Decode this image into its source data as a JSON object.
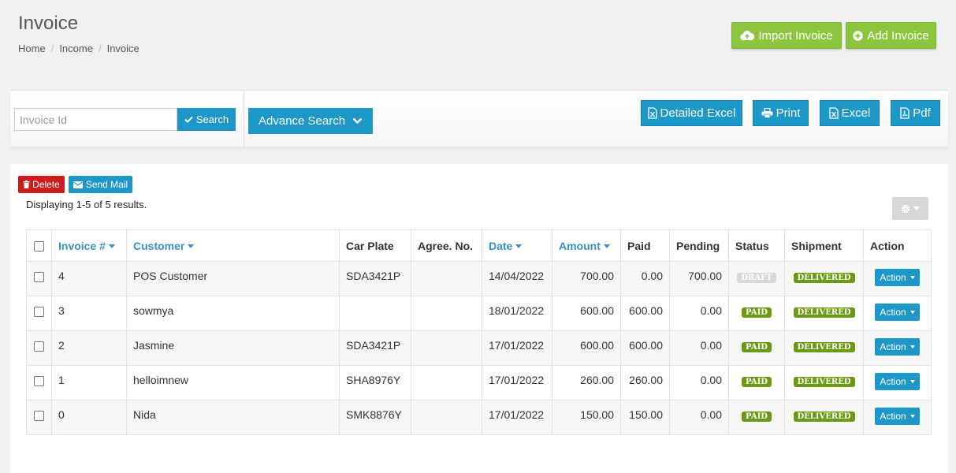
{
  "header": {
    "title": "Invoice",
    "breadcrumb": [
      "Home",
      "Income",
      "Invoice"
    ],
    "import_label": "Import Invoice",
    "add_label": "Add Invoice"
  },
  "toolbar": {
    "search_placeholder": "Invoice Id",
    "search_value": "",
    "search_label": "Search",
    "advance_label": "Advance Search",
    "detailed_excel_label": "Detailed Excel",
    "print_label": "Print",
    "excel_label": "Excel",
    "pdf_label": "Pdf"
  },
  "panel": {
    "delete_label": "Delete",
    "mail_label": "Send Mail",
    "summary": "Displaying 1-5 of 5 results."
  },
  "table": {
    "columns": [
      "Invoice #",
      "Customer",
      "Car Plate",
      "Agree. No.",
      "Date",
      "Amount",
      "Paid",
      "Pending",
      "Status",
      "Shipment",
      "Action"
    ],
    "rows": [
      {
        "invoice": "4",
        "customer": "POS Customer",
        "plate": "SDA3421P",
        "agree": "",
        "date": "14/04/2022",
        "amount": "700.00",
        "paid": "0.00",
        "pending": "700.00",
        "status": "DRAFT",
        "shipment": "DELIVERED",
        "action": "Action"
      },
      {
        "invoice": "3",
        "customer": "sowmya",
        "plate": "",
        "agree": "",
        "date": "18/01/2022",
        "amount": "600.00",
        "paid": "600.00",
        "pending": "0.00",
        "status": "PAID",
        "shipment": "DELIVERED",
        "action": "Action"
      },
      {
        "invoice": "2",
        "customer": "Jasmine",
        "plate": "SDA3421P",
        "agree": "",
        "date": "17/01/2022",
        "amount": "600.00",
        "paid": "600.00",
        "pending": "0.00",
        "status": "PAID",
        "shipment": "DELIVERED",
        "action": "Action"
      },
      {
        "invoice": "1",
        "customer": "helloimnew",
        "plate": "SHA8976Y",
        "agree": "",
        "date": "17/01/2022",
        "amount": "260.00",
        "paid": "260.00",
        "pending": "0.00",
        "status": "PAID",
        "shipment": "DELIVERED",
        "action": "Action"
      },
      {
        "invoice": "0",
        "customer": "Nida",
        "plate": "SMK8876Y",
        "agree": "",
        "date": "17/01/2022",
        "amount": "150.00",
        "paid": "150.00",
        "pending": "0.00",
        "status": "PAID",
        "shipment": "DELIVERED",
        "action": "Action"
      }
    ]
  },
  "colors": {
    "green_button": "#8cc63f",
    "blue_button": "#1d96c8",
    "delete_button": "#cc1c1c",
    "badge_green": "#6a9a12",
    "badge_draft": "#d8d8d8",
    "sort_link": "#3a8fc4"
  },
  "icons": {
    "import": "cloud-upload-icon",
    "add": "plus-circle-icon",
    "search": "check-icon",
    "advance": "chevron-down-icon",
    "detailed_excel": "excel-file-icon",
    "print": "printer-icon",
    "excel": "excel-file-icon",
    "pdf": "pdf-file-icon",
    "delete": "trash-icon",
    "mail": "envelope-icon",
    "settings": "gear-icon"
  }
}
